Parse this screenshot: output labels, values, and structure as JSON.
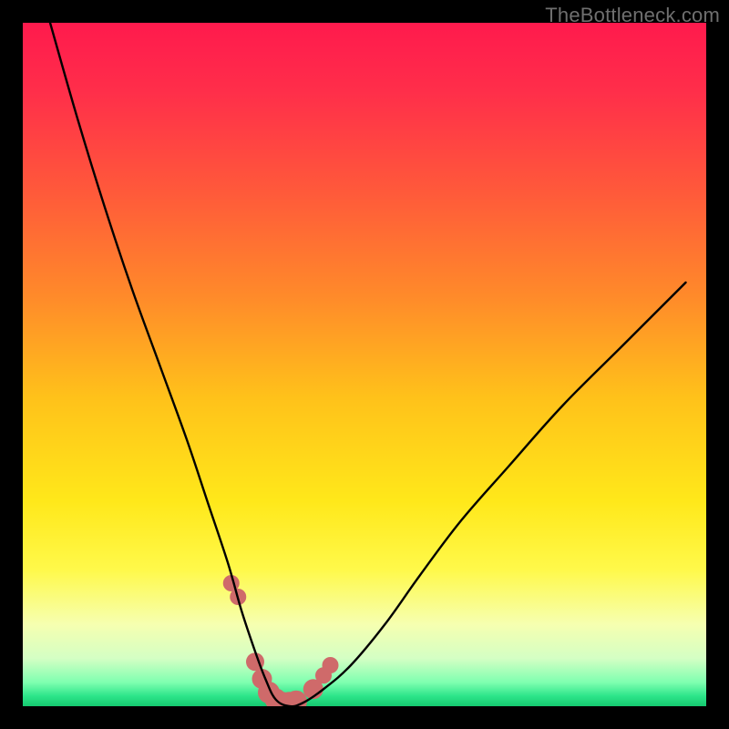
{
  "watermark": {
    "text": "TheBottleneck.com"
  },
  "colors": {
    "frame": "#000000",
    "curve": "#000000",
    "markers": "#cf6a6a",
    "gradient_stops": [
      {
        "offset": 0.0,
        "color": "#ff1a4d"
      },
      {
        "offset": 0.1,
        "color": "#ff2e4a"
      },
      {
        "offset": 0.25,
        "color": "#ff5a3a"
      },
      {
        "offset": 0.4,
        "color": "#ff8a2a"
      },
      {
        "offset": 0.55,
        "color": "#ffc21a"
      },
      {
        "offset": 0.7,
        "color": "#ffe81a"
      },
      {
        "offset": 0.8,
        "color": "#fff94a"
      },
      {
        "offset": 0.88,
        "color": "#f6ffb0"
      },
      {
        "offset": 0.93,
        "color": "#d4ffc4"
      },
      {
        "offset": 0.965,
        "color": "#7fffb0"
      },
      {
        "offset": 0.985,
        "color": "#2de58a"
      },
      {
        "offset": 1.0,
        "color": "#15c86f"
      }
    ]
  },
  "chart_data": {
    "type": "line",
    "title": "",
    "xlabel": "",
    "ylabel": "",
    "xlim": [
      0,
      100
    ],
    "ylim": [
      0,
      100
    ],
    "series": [
      {
        "name": "bottleneck-curve",
        "x": [
          4,
          8,
          12,
          16,
          20,
          24,
          27,
          30,
          32,
          34,
          35.5,
          37,
          39,
          41,
          44,
          48,
          53,
          58,
          64,
          71,
          79,
          88,
          97
        ],
        "y": [
          100,
          86,
          73,
          61,
          50,
          39,
          30,
          21,
          14,
          8,
          4,
          1,
          0,
          0.5,
          2.5,
          6,
          12,
          19,
          27,
          35,
          44,
          53,
          62
        ]
      }
    ],
    "markers": {
      "name": "highlighted-points",
      "x": [
        30.5,
        31.5,
        34.0,
        35.0,
        36.0,
        37.0,
        38.0,
        39.0,
        40.0,
        42.5,
        44.0,
        45.0
      ],
      "y": [
        18.0,
        16.0,
        6.5,
        4.0,
        2.0,
        1.0,
        0.5,
        0.5,
        0.7,
        2.5,
        4.5,
        6.0
      ],
      "radius": [
        9,
        9,
        10,
        11,
        12,
        12,
        12,
        12,
        12,
        11,
        9,
        9
      ]
    }
  }
}
